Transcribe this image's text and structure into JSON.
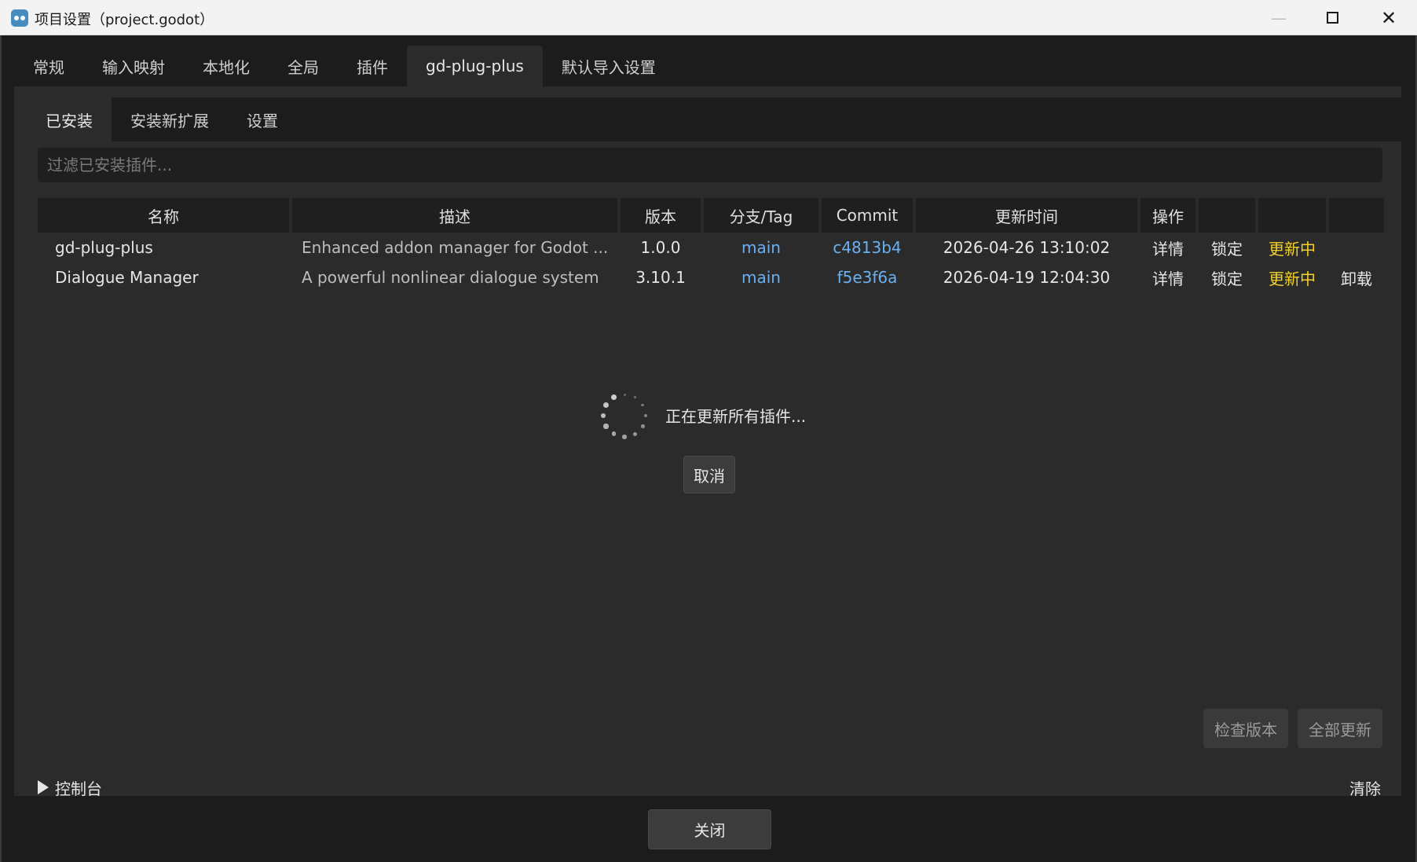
{
  "window": {
    "title": "项目设置（project.godot）",
    "icon": "godot-icon",
    "minimize_glyph": "—",
    "close_glyph": "✕"
  },
  "top_tabs": [
    {
      "label": "常规"
    },
    {
      "label": "输入映射"
    },
    {
      "label": "本地化"
    },
    {
      "label": "全局"
    },
    {
      "label": "插件"
    },
    {
      "label": "gd-plug-plus",
      "active": true
    },
    {
      "label": "默认导入设置"
    }
  ],
  "sub_tabs": [
    {
      "label": "已安装",
      "active": true
    },
    {
      "label": "安装新扩展"
    },
    {
      "label": "设置"
    }
  ],
  "filter": {
    "placeholder": "过滤已安装插件...",
    "value": ""
  },
  "table": {
    "headers": [
      "名称",
      "描述",
      "版本",
      "分支/Tag",
      "Commit",
      "更新时间",
      "操作",
      "",
      "",
      ""
    ],
    "rows": [
      {
        "name": "gd-plug-plus",
        "description": "Enhanced addon manager for Godot ...",
        "version": "1.0.0",
        "branch": "main",
        "commit": "c4813b4",
        "updated": "2026-04-26 13:10:02",
        "details": "详情",
        "lock": "锁定",
        "status": "更新中",
        "uninstall": ""
      },
      {
        "name": "Dialogue Manager",
        "description": "A powerful nonlinear dialogue system",
        "version": "3.10.1",
        "branch": "main",
        "commit": "f5e3f6a",
        "updated": "2026-04-19 12:04:30",
        "details": "详情",
        "lock": "锁定",
        "status": "更新中",
        "uninstall": "卸载"
      }
    ]
  },
  "loading": {
    "text": "正在更新所有插件...",
    "cancel_label": "取消"
  },
  "actions": {
    "check_version": "检查版本",
    "update_all": "全部更新"
  },
  "console": {
    "label": "控制台",
    "clear_label": "清除"
  },
  "footer": {
    "close_label": "关闭"
  },
  "colors": {
    "link": "#6ab0f3",
    "status_updating": "#f2d12c",
    "panel": "#2b2b2b",
    "background": "#1c1c1c"
  }
}
